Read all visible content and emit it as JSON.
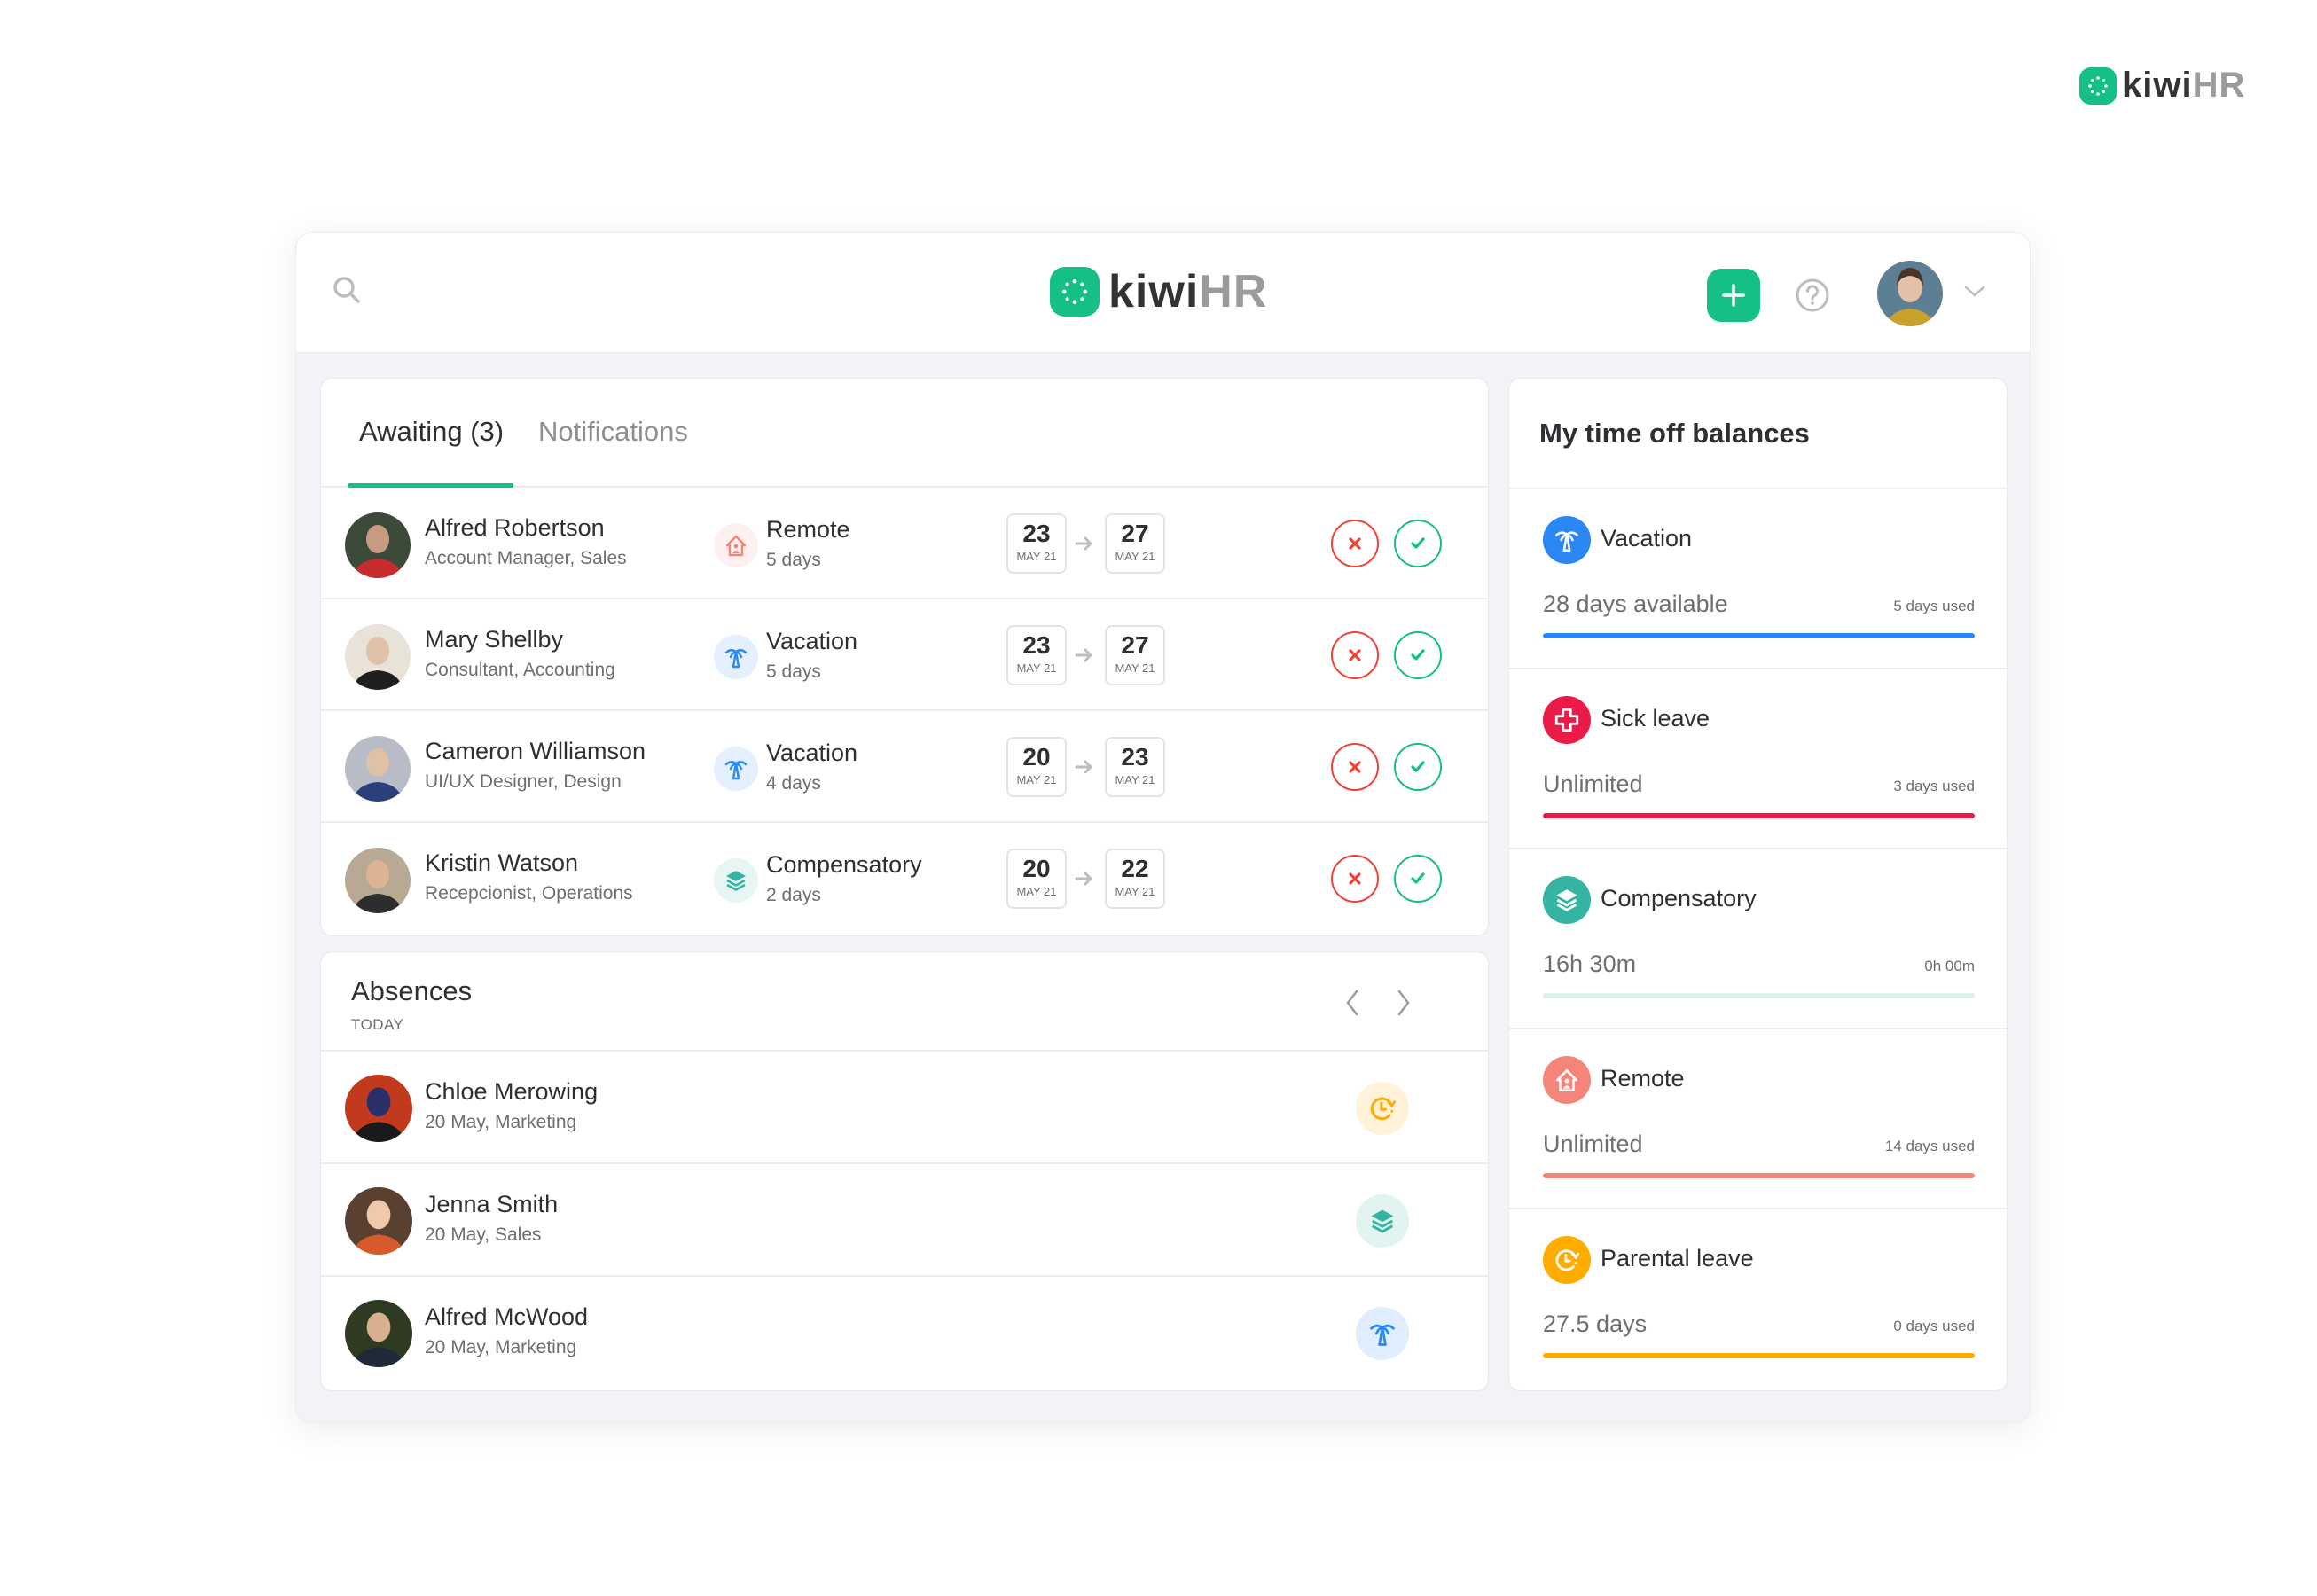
{
  "brand": {
    "name_main": "kiwi",
    "name_suffix": "HR",
    "color": "#16bf84"
  },
  "topbar": {
    "search_icon": "search-icon",
    "add_icon": "plus-icon",
    "help_icon": "help-circle-icon",
    "user_menu_icon": "chevron-down-icon"
  },
  "awaiting": {
    "tabs": [
      {
        "label": "Awaiting (3)",
        "active": true
      },
      {
        "label": "Notifications",
        "active": false
      }
    ],
    "requests": [
      {
        "name": "Alfred Robertson",
        "role": "Account Manager, Sales",
        "type": "Remote",
        "type_icon": "remote-home-icon",
        "duration": "5 days",
        "from_day": "23",
        "from_month": "MAY 21",
        "to_day": "27",
        "to_month": "MAY 21"
      },
      {
        "name": "Mary Shellby",
        "role": "Consultant, Accounting",
        "type": "Vacation",
        "type_icon": "palm-tree-icon",
        "duration": "5 days",
        "from_day": "23",
        "from_month": "MAY 21",
        "to_day": "27",
        "to_month": "MAY 21"
      },
      {
        "name": "Cameron Williamson",
        "role": "UI/UX Designer, Design",
        "type": "Vacation",
        "type_icon": "palm-tree-icon",
        "duration": "4 days",
        "from_day": "20",
        "from_month": "MAY 21",
        "to_day": "23",
        "to_month": "MAY 21"
      },
      {
        "name": "Kristin Watson",
        "role": "Recepcionist, Operations",
        "type": "Compensatory",
        "type_icon": "layers-icon",
        "duration": "2 days",
        "from_day": "20",
        "from_month": "MAY 21",
        "to_day": "22",
        "to_month": "MAY 21"
      }
    ]
  },
  "absences": {
    "title": "Absences",
    "subtitle": "TODAY",
    "items": [
      {
        "name": "Chloe Merowing",
        "meta": "20 May, Marketing",
        "type_icon": "parental-clock-icon"
      },
      {
        "name": "Jenna Smith",
        "meta": "20 May, Sales",
        "type_icon": "layers-icon"
      },
      {
        "name": "Alfred McWood",
        "meta": "20 May, Marketing",
        "type_icon": "palm-tree-icon"
      }
    ]
  },
  "balances": {
    "title": "My time off balances",
    "items": [
      {
        "name": "Vacation",
        "available": "28 days available",
        "used": "5 days used",
        "color": "#2b87f3",
        "fill_percent": 100,
        "icon": "palm-tree-icon"
      },
      {
        "name": "Sick leave",
        "available": "Unlimited",
        "used": "3 days used",
        "color": "#eb1b47",
        "fill_percent": 100,
        "icon": "medical-cross-icon"
      },
      {
        "name": "Compensatory",
        "available": "16h 30m",
        "used": "0h 00m",
        "color": "#35b3a3",
        "fill_percent": 0,
        "icon": "layers-icon"
      },
      {
        "name": "Remote",
        "available": "Unlimited",
        "used": "14 days used",
        "color": "#f5857a",
        "fill_percent": 100,
        "icon": "remote-home-icon"
      },
      {
        "name": "Parental leave",
        "available": "27.5 days",
        "used": "0 days used",
        "color": "#ffab00",
        "fill_percent": 100,
        "icon": "parental-clock-icon"
      }
    ]
  },
  "colors": {
    "vacation": "#2b87f3",
    "sick": "#eb1b47",
    "compensatory": "#35b3a3",
    "remote": "#f5857a",
    "parental": "#ffab00",
    "reject": "#ef4136",
    "approve": "#16bf84"
  }
}
